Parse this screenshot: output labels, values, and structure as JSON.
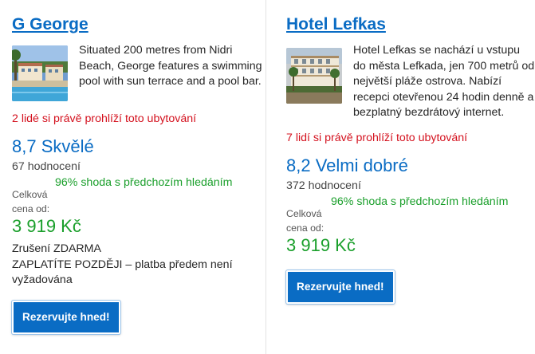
{
  "listings": [
    {
      "name": "G George",
      "description": "Situated 200 metres from Nidri Beach, George features a swimming pool with sun terrace and a pool bar.",
      "viewing": "2 lidé si právě prohlíží toto ubytování",
      "score": "8,7 Skvělé",
      "reviews": "67 hodnocení",
      "match": "96% shoda s předchozím hledáním",
      "price_label_1": "Celková",
      "price_label_2": "cena od:",
      "price": "3 919 Kč",
      "cancel_1": "Zrušení ZDARMA",
      "cancel_2": "ZAPLATÍTE POZDĚJI – platba předem není vyžadována",
      "button": "Rezervujte hned!"
    },
    {
      "name": "Hotel Lefkas",
      "description": "Hotel Lefkas se nachází u vstupu do města Lefkada, jen 700 metrů od největší pláže ostrova. Nabízí recepci otevřenou 24 hodin denně a bezplatný bezdrátový internet.",
      "viewing": "7 lidí si právě prohlíží toto ubytování",
      "score": "8,2 Velmi dobré",
      "reviews": "372 hodnocení",
      "match": "96% shoda s předchozím hledáním",
      "price_label_1": "Celková",
      "price_label_2": "cena od:",
      "price": "3 919 Kč",
      "button": "Rezervujte hned!"
    }
  ],
  "colors": {
    "link": "#0a6cc4",
    "alert": "#d4111e",
    "positive": "#1a9f2b",
    "button": "#0a6cc4"
  }
}
